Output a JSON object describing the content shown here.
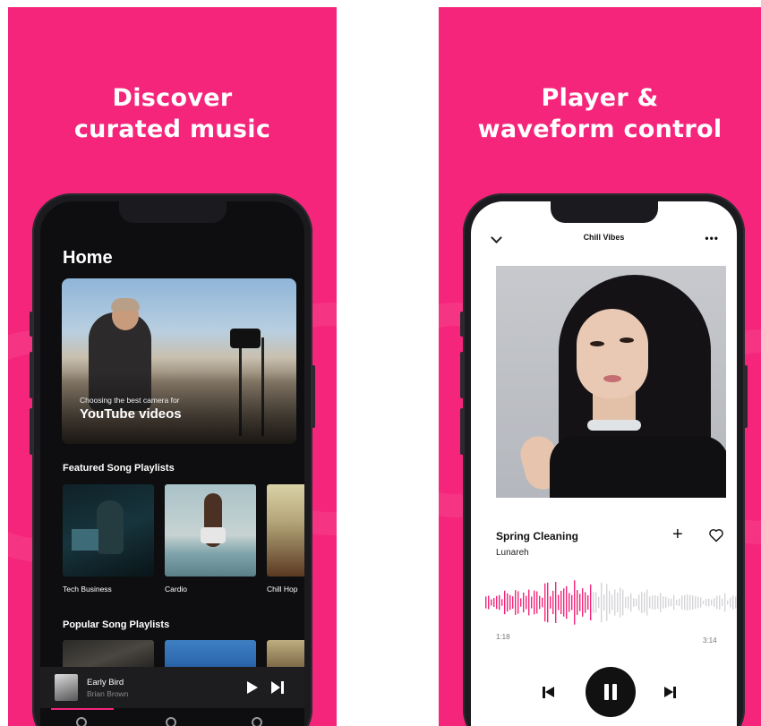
{
  "left_panel": {
    "headline_line1": "Discover",
    "headline_line2": "curated music",
    "home": {
      "title": "Home",
      "hero": {
        "subtitle": "Choosing the best camera for",
        "title": "YouTube videos"
      },
      "featured_title": "Featured Song Playlists",
      "featured": [
        {
          "label": "Tech Business"
        },
        {
          "label": "Cardio"
        },
        {
          "label": "Chill Hop"
        }
      ],
      "popular_title": "Popular Song Playlists",
      "mini_player": {
        "title": "Early Bird",
        "artist": "Brian Brown"
      }
    }
  },
  "right_panel": {
    "headline_line1": "Player &",
    "headline_line2": "waveform control",
    "player": {
      "playlist_title": "Chill Vibes",
      "more_icon": "more-horizontal-icon",
      "song": "Spring Cleaning",
      "artist": "Lunareh",
      "elapsed": "1:18",
      "duration": "3:14",
      "progress": 0.4
    }
  },
  "colors": {
    "brand": "#f5257b",
    "dark_bg": "#0e0e10",
    "waveform_played": "#f5257b",
    "waveform_remaining": "#d4d4d8"
  }
}
